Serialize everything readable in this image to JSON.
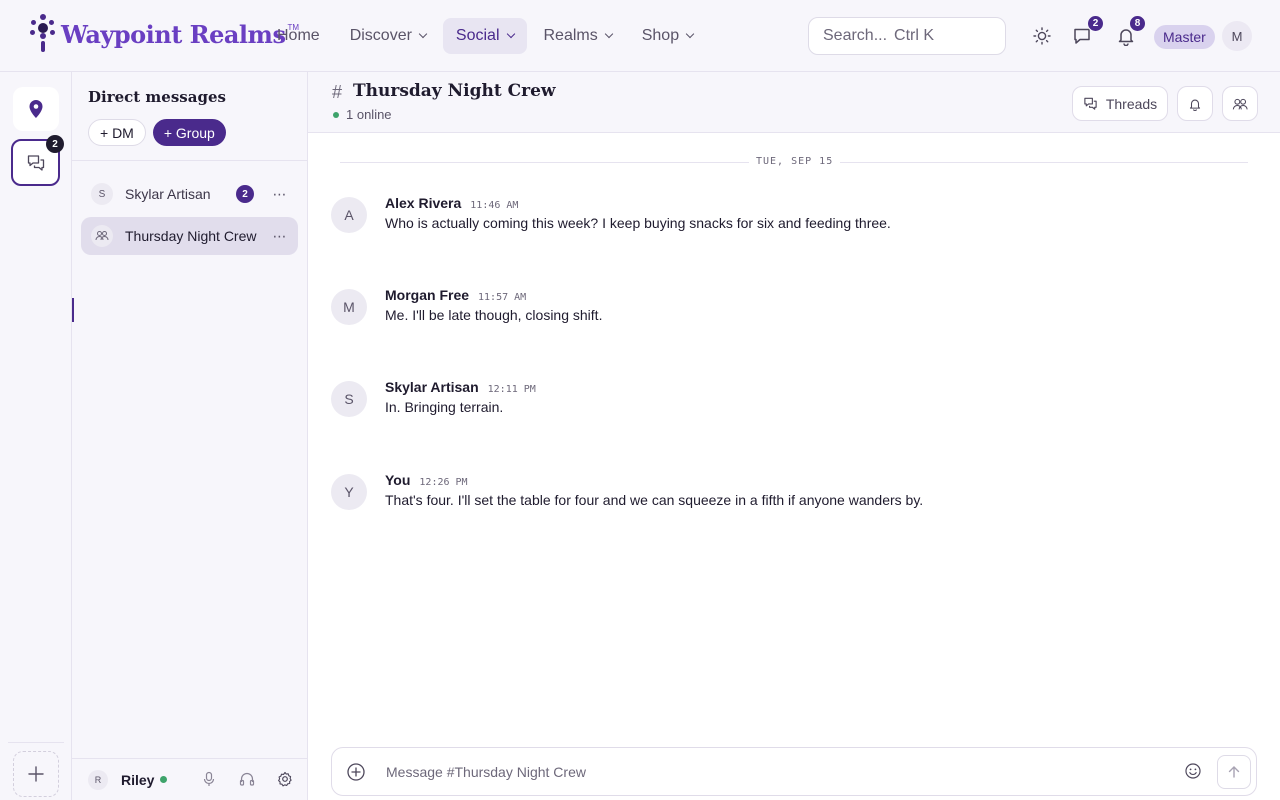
{
  "brand": {
    "name": "Waypoint Realms",
    "tm": "TM"
  },
  "nav": {
    "items": [
      {
        "label": "Home",
        "dropdown": false,
        "active": false
      },
      {
        "label": "Discover",
        "dropdown": true,
        "active": false
      },
      {
        "label": "Social",
        "dropdown": true,
        "active": true
      },
      {
        "label": "Realms",
        "dropdown": true,
        "active": false
      },
      {
        "label": "Shop",
        "dropdown": true,
        "active": false
      }
    ]
  },
  "search": {
    "placeholder": "Search...",
    "shortcut": "Ctrl K"
  },
  "topbar": {
    "messages_badge": "2",
    "notifications_badge": "8",
    "role": "Master",
    "user_initial": "M"
  },
  "rail": {
    "chat_badge": "2"
  },
  "dm": {
    "title": "Direct messages",
    "add_dm": "+ DM",
    "add_group": "+ Group",
    "items": [
      {
        "initial": "S",
        "name": "Skylar Artisan",
        "unread": "2",
        "active": false
      },
      {
        "initial": "",
        "name": "Thursday Night Crew",
        "unread": "",
        "active": true
      }
    ],
    "footer": {
      "initial": "R",
      "name": "Riley"
    }
  },
  "channel": {
    "title": "Thursday Night Crew",
    "online": "1 online",
    "threads_label": "Threads",
    "date_divider": "TUE, SEP 15",
    "composer_placeholder": "Message #Thursday Night Crew"
  },
  "messages": [
    {
      "initial": "A",
      "author": "Alex Rivera",
      "time": "11:46 AM",
      "text": "Who is actually coming this week? I keep buying snacks for six and feeding three."
    },
    {
      "initial": "M",
      "author": "Morgan Free",
      "time": "11:57 AM",
      "text": "Me. I'll be late though, closing shift."
    },
    {
      "initial": "S",
      "author": "Skylar Artisan",
      "time": "12:11 PM",
      "text": "In. Bringing terrain."
    },
    {
      "initial": "Y",
      "author": "You",
      "time": "12:26 PM",
      "text": "That's four. I'll set the table for four and we can squeeze in a fifth if anyone wanders by."
    }
  ],
  "colors": {
    "accent": "#4a2a8c",
    "brand": "#6a3fc2",
    "online": "#3ea36b"
  }
}
